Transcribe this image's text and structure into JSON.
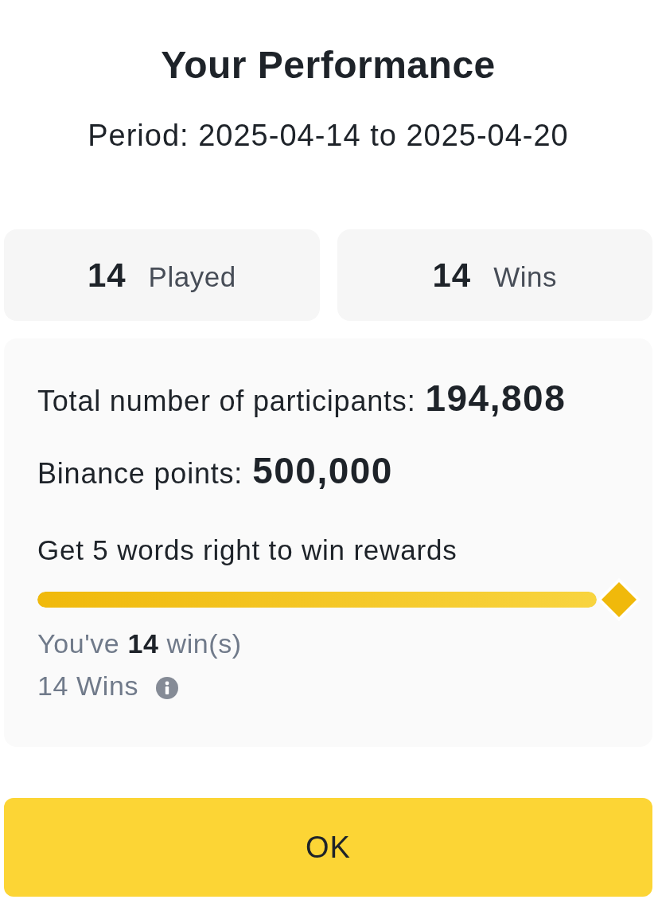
{
  "header": {
    "title": "Your Performance",
    "period": "Period: 2025-04-14 to 2025-04-20"
  },
  "stats": [
    {
      "value": "14",
      "label": "Played"
    },
    {
      "value": "14",
      "label": "Wins"
    }
  ],
  "summary": {
    "lines": [
      {
        "label": "Total number of participants:",
        "value": "194,808"
      },
      {
        "label": "Binance points:",
        "value": "500,000"
      }
    ],
    "goal": "Get 5 words right to win rewards",
    "progress": {
      "level": 1
    },
    "wins_text": "You've **14** win(s)",
    "wins_count": "14 Wins"
  },
  "button": {
    "label": "OK"
  }
}
